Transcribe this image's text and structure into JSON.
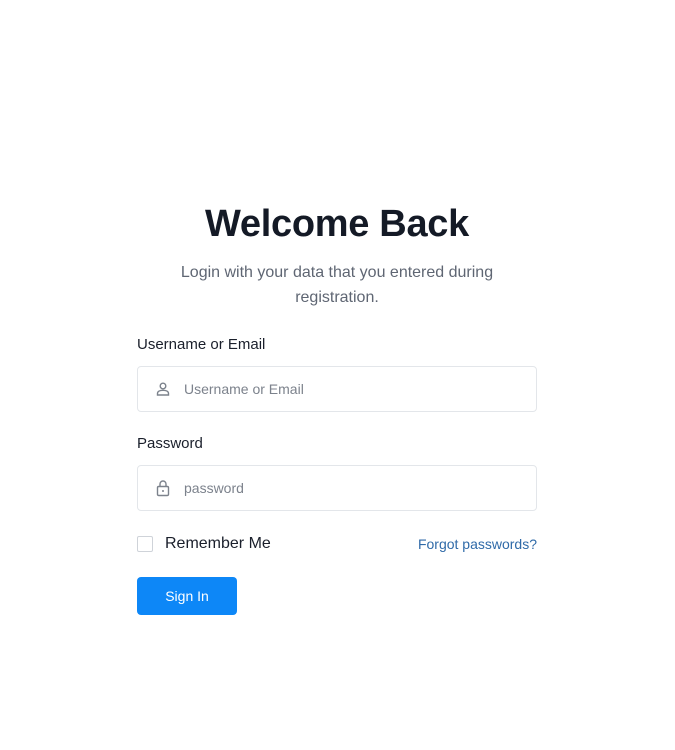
{
  "header": {
    "title": "Welcome Back",
    "subtitle": "Login with your data that you entered during registration."
  },
  "username": {
    "label": "Username or Email",
    "placeholder": "Username or Email",
    "value": "",
    "icon": "user-icon"
  },
  "password": {
    "label": "Password",
    "placeholder": "password",
    "value": "",
    "icon": "lock-icon"
  },
  "options": {
    "remember_label": "Remember Me",
    "remember_checked": false,
    "forgot_label": "Forgot passwords?"
  },
  "actions": {
    "signin_label": "Sign In"
  },
  "colors": {
    "primary": "#0d87f7",
    "link": "#2f6aa8",
    "title": "#141a26",
    "muted": "#5f6673",
    "border": "#e3e6ea"
  }
}
